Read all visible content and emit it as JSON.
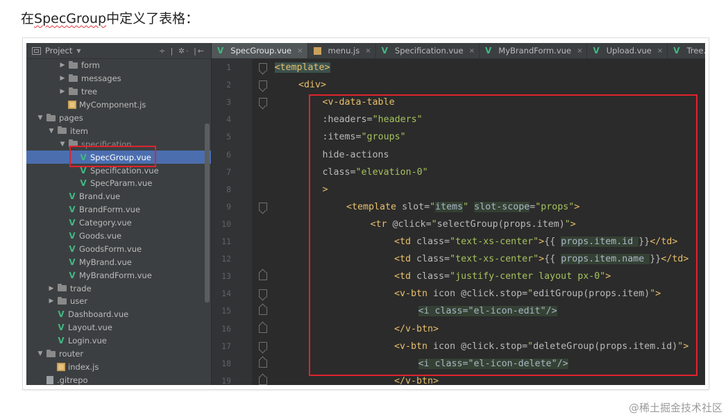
{
  "heading": {
    "prefix": "在",
    "spell_word": "SpecGroup",
    "suffix": "中定义了表格："
  },
  "project_panel": {
    "title": "Project",
    "tools": "÷ | ✲· |←"
  },
  "tree": [
    {
      "label": "form",
      "kind": "folder",
      "indent": 2,
      "arrow": "right"
    },
    {
      "label": "messages",
      "kind": "folder",
      "indent": 2,
      "arrow": "right"
    },
    {
      "label": "tree",
      "kind": "folder",
      "indent": 2,
      "arrow": "right"
    },
    {
      "label": "MyComponent.js",
      "kind": "js",
      "indent": 2,
      "arrow": ""
    },
    {
      "label": "pages",
      "kind": "folder",
      "indent": 0,
      "arrow": "down"
    },
    {
      "label": "item",
      "kind": "folder",
      "indent": 1,
      "arrow": "down"
    },
    {
      "label": "specification",
      "kind": "folder",
      "indent": 2,
      "arrow": "down"
    },
    {
      "label": "SpecGroup.vue",
      "kind": "vue",
      "indent": 3,
      "arrow": "",
      "selected": true
    },
    {
      "label": "Specification.vue",
      "kind": "vue",
      "indent": 3,
      "arrow": ""
    },
    {
      "label": "SpecParam.vue",
      "kind": "vue",
      "indent": 3,
      "arrow": ""
    },
    {
      "label": "Brand.vue",
      "kind": "vue",
      "indent": 2,
      "arrow": ""
    },
    {
      "label": "BrandForm.vue",
      "kind": "vue",
      "indent": 2,
      "arrow": ""
    },
    {
      "label": "Category.vue",
      "kind": "vue",
      "indent": 2,
      "arrow": ""
    },
    {
      "label": "Goods.vue",
      "kind": "vue",
      "indent": 2,
      "arrow": ""
    },
    {
      "label": "GoodsForm.vue",
      "kind": "vue",
      "indent": 2,
      "arrow": ""
    },
    {
      "label": "MyBrand.vue",
      "kind": "vue",
      "indent": 2,
      "arrow": ""
    },
    {
      "label": "MyBrandForm.vue",
      "kind": "vue",
      "indent": 2,
      "arrow": ""
    },
    {
      "label": "trade",
      "kind": "folder",
      "indent": 1,
      "arrow": "right"
    },
    {
      "label": "user",
      "kind": "folder",
      "indent": 1,
      "arrow": "right"
    },
    {
      "label": "Dashboard.vue",
      "kind": "vue",
      "indent": 1,
      "arrow": ""
    },
    {
      "label": "Layout.vue",
      "kind": "vue",
      "indent": 1,
      "arrow": ""
    },
    {
      "label": "Login.vue",
      "kind": "vue",
      "indent": 1,
      "arrow": ""
    },
    {
      "label": "router",
      "kind": "folder",
      "indent": 0,
      "arrow": "down"
    },
    {
      "label": "index.js",
      "kind": "js",
      "indent": 1,
      "arrow": ""
    },
    {
      "label": ".gitrepo",
      "kind": "file",
      "indent": 0,
      "arrow": ""
    }
  ],
  "tabs": [
    {
      "label": "SpecGroup.vue",
      "icon": "vue",
      "active": true,
      "close": "×"
    },
    {
      "label": "menu.js",
      "icon": "js",
      "active": false,
      "close": "×"
    },
    {
      "label": "Specification.vue",
      "icon": "vue",
      "active": false,
      "close": "×"
    },
    {
      "label": "MyBrandForm.vue",
      "icon": "vue",
      "active": false,
      "close": "×"
    },
    {
      "label": "Upload.vue",
      "icon": "vue",
      "active": false,
      "close": "×"
    },
    {
      "label": "Tree.vue",
      "icon": "vue",
      "active": false,
      "close": ""
    }
  ],
  "code_lines": [
    {
      "n": "1",
      "indent": 0,
      "tokens": [
        [
          "hlt",
          "<template>"
        ]
      ]
    },
    {
      "n": "2",
      "indent": 1,
      "tokens": [
        [
          "tag",
          "<div>"
        ]
      ]
    },
    {
      "n": "3",
      "indent": 2,
      "tokens": [
        [
          "tag",
          "<v-data-table"
        ]
      ]
    },
    {
      "n": "4",
      "indent": 2,
      "tokens": [
        [
          "attr",
          ":headers="
        ],
        [
          "str",
          "\"headers\""
        ]
      ]
    },
    {
      "n": "5",
      "indent": 2,
      "tokens": [
        [
          "attr",
          ":items="
        ],
        [
          "str",
          "\"groups\""
        ]
      ]
    },
    {
      "n": "6",
      "indent": 2,
      "tokens": [
        [
          "attr",
          "hide-actions"
        ]
      ]
    },
    {
      "n": "7",
      "indent": 2,
      "tokens": [
        [
          "attr",
          "class="
        ],
        [
          "str",
          "\"elevation-0\""
        ]
      ]
    },
    {
      "n": "8",
      "indent": 2,
      "tokens": [
        [
          "tag",
          ">"
        ]
      ]
    },
    {
      "n": "9",
      "indent": 3,
      "tokens": [
        [
          "tag",
          "<template "
        ],
        [
          "attr",
          "slot="
        ],
        [
          "str",
          "\""
        ],
        [
          "hl",
          "items"
        ],
        [
          "str",
          "\""
        ],
        [
          "attr",
          " "
        ],
        [
          "hl",
          "slot-scope"
        ],
        [
          "attr",
          "="
        ],
        [
          "str",
          "\"props\""
        ],
        [
          "tag",
          ">"
        ]
      ]
    },
    {
      "n": "10",
      "indent": 4,
      "tokens": [
        [
          "tag",
          "<tr "
        ],
        [
          "attr",
          "@click="
        ],
        [
          "str",
          "\""
        ],
        [
          "attr",
          "selectGroup(props.item)"
        ],
        [
          "str",
          "\""
        ],
        [
          "tag",
          ">"
        ]
      ]
    },
    {
      "n": "11",
      "indent": 5,
      "tokens": [
        [
          "tag",
          "<td "
        ],
        [
          "attr",
          "class="
        ],
        [
          "str",
          "\"text-xs-center\""
        ],
        [
          "tag",
          ">"
        ],
        [
          "attr",
          "{{ "
        ],
        [
          "hl",
          "props.item.id "
        ],
        [
          "attr",
          "}}"
        ],
        [
          "tag",
          "</td>"
        ]
      ]
    },
    {
      "n": "12",
      "indent": 5,
      "tokens": [
        [
          "tag",
          "<td "
        ],
        [
          "attr",
          "class="
        ],
        [
          "str",
          "\"text-xs-center\""
        ],
        [
          "tag",
          ">"
        ],
        [
          "attr",
          "{{ "
        ],
        [
          "hl",
          "props.item.name "
        ],
        [
          "attr",
          "}}"
        ],
        [
          "tag",
          "</td>"
        ]
      ]
    },
    {
      "n": "13",
      "indent": 5,
      "tokens": [
        [
          "tag",
          "<td "
        ],
        [
          "attr",
          "class="
        ],
        [
          "str",
          "\"justify-center layout px-0\""
        ],
        [
          "tag",
          ">"
        ]
      ]
    },
    {
      "n": "14",
      "indent": 5,
      "tokens": [
        [
          "tag",
          "<v-btn "
        ],
        [
          "attr",
          "icon @click.stop="
        ],
        [
          "str",
          "\""
        ],
        [
          "attr",
          "editGroup(props.item)"
        ],
        [
          "str",
          "\""
        ],
        [
          "tag",
          ">"
        ]
      ]
    },
    {
      "n": "15",
      "indent": 6,
      "tokens": [
        [
          "hl",
          "<i class=\"el-icon-edit\"/>"
        ]
      ]
    },
    {
      "n": "16",
      "indent": 5,
      "tokens": [
        [
          "tag",
          "</v-btn>"
        ]
      ]
    },
    {
      "n": "17",
      "indent": 5,
      "tokens": [
        [
          "tag",
          "<v-btn "
        ],
        [
          "attr",
          "icon @click.stop="
        ],
        [
          "str",
          "\""
        ],
        [
          "attr",
          "deleteGroup(props.item.id)"
        ],
        [
          "str",
          "\""
        ],
        [
          "tag",
          ">"
        ]
      ]
    },
    {
      "n": "18",
      "indent": 6,
      "tokens": [
        [
          "hl",
          "<i class=\"el-icon-delete\"/>"
        ]
      ]
    },
    {
      "n": "19",
      "indent": 5,
      "tokens": [
        [
          "tag",
          "</v-btn>"
        ]
      ]
    }
  ],
  "watermark": "@稀土掘金技术社区",
  "colors": {
    "highlight_box": "#e0232d",
    "selection": "#4b6eaf",
    "vue_icon": "#41b883"
  }
}
